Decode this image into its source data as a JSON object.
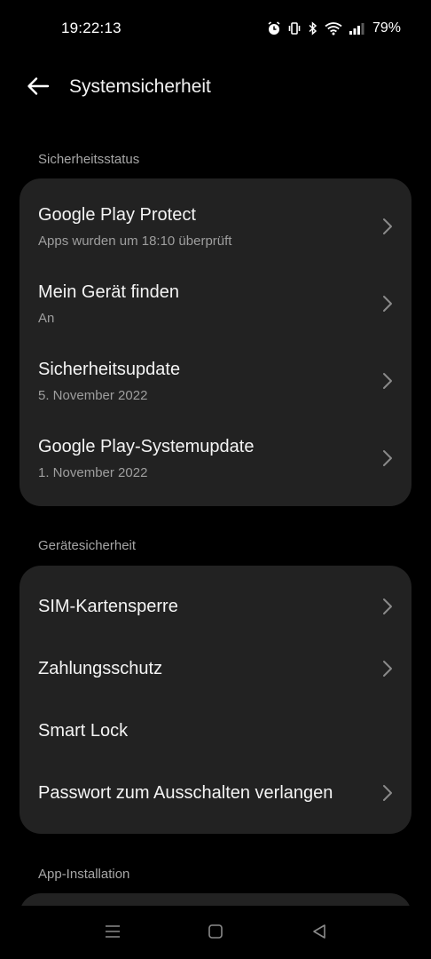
{
  "status_bar": {
    "time": "19:22:13",
    "battery": "79%",
    "icons": [
      "alarm-icon",
      "vibrate-icon",
      "bluetooth-icon",
      "wifi-icon",
      "signal-icon"
    ]
  },
  "header": {
    "title": "Systemsicherheit",
    "back_icon": "arrow-left-icon"
  },
  "sections": [
    {
      "title": "Sicherheitsstatus",
      "items": [
        {
          "title": "Google Play Protect",
          "subtitle": "Apps wurden um 18:10 überprüft",
          "chevron": true
        },
        {
          "title": "Mein Gerät finden",
          "subtitle": "An",
          "chevron": true
        },
        {
          "title": "Sicherheitsupdate",
          "subtitle": "5. November 2022",
          "chevron": true
        },
        {
          "title": "Google Play-Systemupdate",
          "subtitle": "1. November 2022",
          "chevron": true
        }
      ]
    },
    {
      "title": "Gerätesicherheit",
      "items": [
        {
          "title": "SIM-Kartensperre",
          "chevron": true
        },
        {
          "title": "Zahlungsschutz",
          "chevron": true
        },
        {
          "title": "Smart Lock",
          "chevron": false
        },
        {
          "title": "Passwort zum Ausschalten verlangen",
          "chevron": true
        }
      ]
    },
    {
      "title": "App-Installation",
      "items": []
    }
  ],
  "nav_bar": {
    "icons": [
      "menu-icon",
      "home-icon",
      "back-triangle-icon"
    ]
  },
  "colors": {
    "background": "#000000",
    "card": "#222222",
    "text_primary": "#f4f4f4",
    "text_secondary": "#9e9e9e",
    "section_title": "#a6a6a6"
  }
}
